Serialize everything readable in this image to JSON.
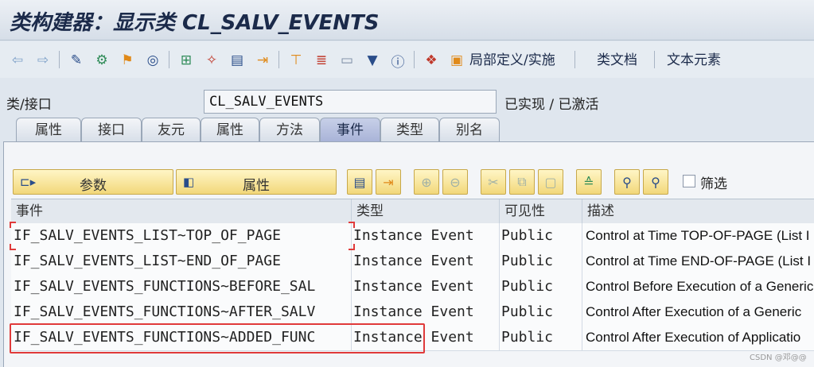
{
  "window": {
    "title": "类构建器：显示类 CL_SALV_EVENTS"
  },
  "toolbar": {
    "icons": [
      "back-arrow-icon",
      "forward-arrow-icon",
      "edit-pencil-icon",
      "object-tree-icon",
      "activate-icon",
      "where-used-icon",
      "display-object-list-icon",
      "pretty-print-icon",
      "test-icon",
      "hierarchy-icon",
      "navigate-icon",
      "local-types-icon",
      "filter-icon",
      "info-icon",
      "object-icon"
    ],
    "local_def_label": "局部定义/实施",
    "class_doc_label": "类文档",
    "text_elements_label": "文本元素"
  },
  "header": {
    "class_label": "类/接口",
    "class_value": "CL_SALV_EVENTS",
    "status": "已实现 / 已激活"
  },
  "tabs": [
    {
      "label": "属性"
    },
    {
      "label": "接口"
    },
    {
      "label": "友元"
    },
    {
      "label": "属性"
    },
    {
      "label": "方法"
    },
    {
      "label": "事件"
    },
    {
      "label": "类型"
    },
    {
      "label": "别名"
    }
  ],
  "buttons": {
    "params_label": "参数",
    "attrs_label": "属性",
    "filter_label": "筛选"
  },
  "grid": {
    "columns": [
      "事件",
      "类型",
      "可见性",
      "描述"
    ],
    "rows": [
      {
        "event": "IF_SALV_EVENTS_LIST~TOP_OF_PAGE",
        "type": "Instance Event",
        "visibility": "Public",
        "desc": "Control at Time TOP-OF-PAGE (List I"
      },
      {
        "event": "IF_SALV_EVENTS_LIST~END_OF_PAGE",
        "type": "Instance Event",
        "visibility": "Public",
        "desc": "Control at Time END-OF-PAGE (List I"
      },
      {
        "event": "IF_SALV_EVENTS_FUNCTIONS~BEFORE_SAL",
        "type": "Instance Event",
        "visibility": "Public",
        "desc": "Control Before Execution of a Generic"
      },
      {
        "event": "IF_SALV_EVENTS_FUNCTIONS~AFTER_SALV",
        "type": "Instance Event",
        "visibility": "Public",
        "desc": "Control After Execution of a Generic"
      },
      {
        "event": "IF_SALV_EVENTS_FUNCTIONS~ADDED_FUNC",
        "type": "Instance Event",
        "visibility": "Public",
        "desc": "Control After Execution of Applicatio"
      }
    ]
  },
  "watermark": "CSDN @邓@@",
  "colors": {
    "highlight": "#e03a3a",
    "active_tab": "#a9b4d8",
    "button": "#f2d87a"
  }
}
